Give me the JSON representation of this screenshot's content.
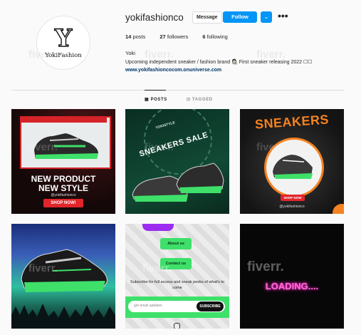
{
  "profile": {
    "avatar_letter": "Y",
    "avatar_name": "YokiFashion",
    "username": "yokifashionco",
    "message_label": "Message",
    "follow_label": "Follow",
    "more_glyph": "⌄",
    "options_glyph": "•••",
    "posts_count": "14",
    "posts_label": "posts",
    "followers_count": "27",
    "followers_label": "followers",
    "following_count": "6",
    "following_label": "following",
    "full_name": "Yoki",
    "bio": "Upcoming independent sneaker / fashion brand 👩🏻‍🎨 First sneaker releasing 2022 ☐☐",
    "website": "www.yokifashioncocom.onuniverse.com"
  },
  "tabs": {
    "posts_label": "POSTS",
    "tagged_label": "TAGGED"
  },
  "watermark": "fiverr.",
  "posts": [
    {
      "heading": "NEW PRODUCT",
      "heading2": "NEW STYLE",
      "handle": "@yokifashionco",
      "cta": "SHOP NOW!"
    },
    {
      "heading": "SNEAKERS SALE",
      "tag": "YOKISTYLE"
    },
    {
      "heading": "SNEAKERS",
      "cta": "SHOP NOW",
      "handle": "@yokifashionco"
    },
    {},
    {
      "button1": "About us",
      "button2": "Contact us",
      "text": "Subscribe for full access and sneak peeks of what's to come",
      "placeholder": "get email updates",
      "cta": "SUBSCRIBE"
    },
    {
      "heading": "LOADING....",
      "watermark": "fiverr."
    }
  ],
  "colors": {
    "accent": "#0095f6",
    "red": "#e2252b",
    "green": "#3ee06a",
    "orange": "#f58220",
    "pink": "#ff4dd2"
  }
}
